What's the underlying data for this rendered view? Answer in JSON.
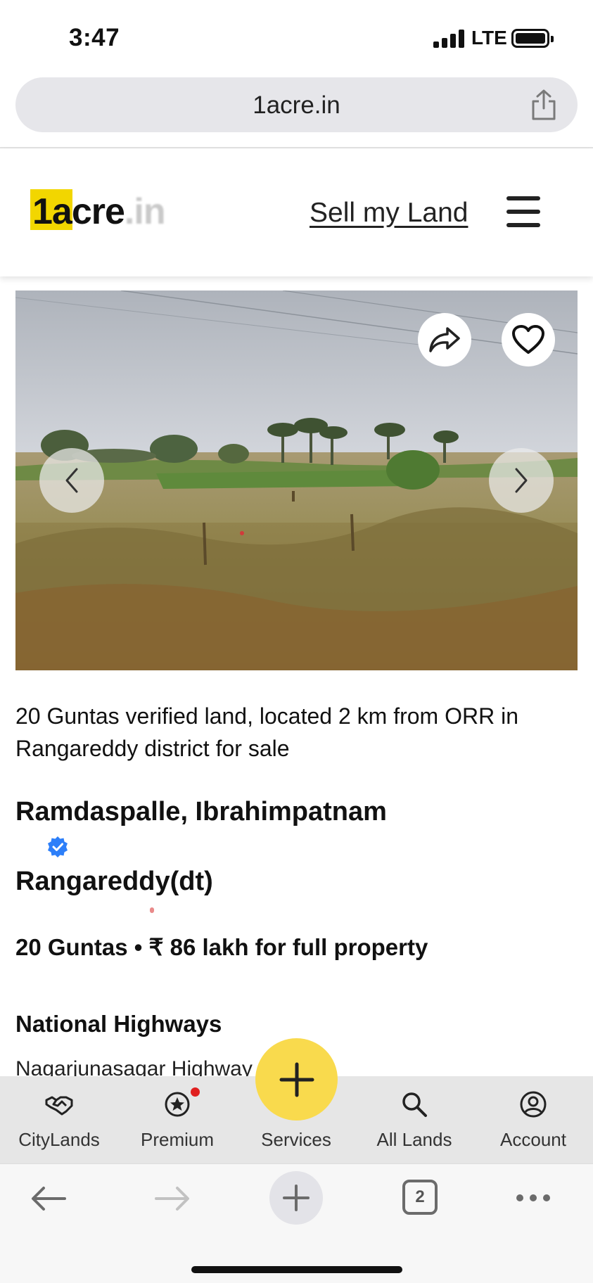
{
  "status_bar": {
    "time": "3:47",
    "network": "LTE"
  },
  "browser": {
    "url": "1acre.in",
    "tab_count": "2"
  },
  "header": {
    "logo_main": "1acre",
    "logo_suffix": ".in",
    "sell_link": "Sell my Land"
  },
  "listing": {
    "description": "20 Guntas verified land, located 2 km from ORR in Rangareddy district for sale",
    "location_line1": "Ramdaspalle, Ibrahimpatnam",
    "location_line2": "Rangareddy(dt)",
    "price_line": "20 Guntas • ₹ 86 lakh for full property",
    "section_title": "National Highways",
    "section_value": "Nagarjunasagar Highway"
  },
  "bottom_nav": {
    "items": [
      {
        "label": "CityLands",
        "icon": "handshake-icon"
      },
      {
        "label": "Premium",
        "icon": "star-badge-icon"
      },
      {
        "label": "Services",
        "icon": "plus-icon"
      },
      {
        "label": "All Lands",
        "icon": "search-icon"
      },
      {
        "label": "Account",
        "icon": "user-circle-icon"
      }
    ]
  },
  "colors": {
    "brand_yellow": "#f9da4d",
    "logo_yellow": "#f2d600",
    "verified_blue": "#2d7ff9",
    "badge_red": "#e02020"
  }
}
